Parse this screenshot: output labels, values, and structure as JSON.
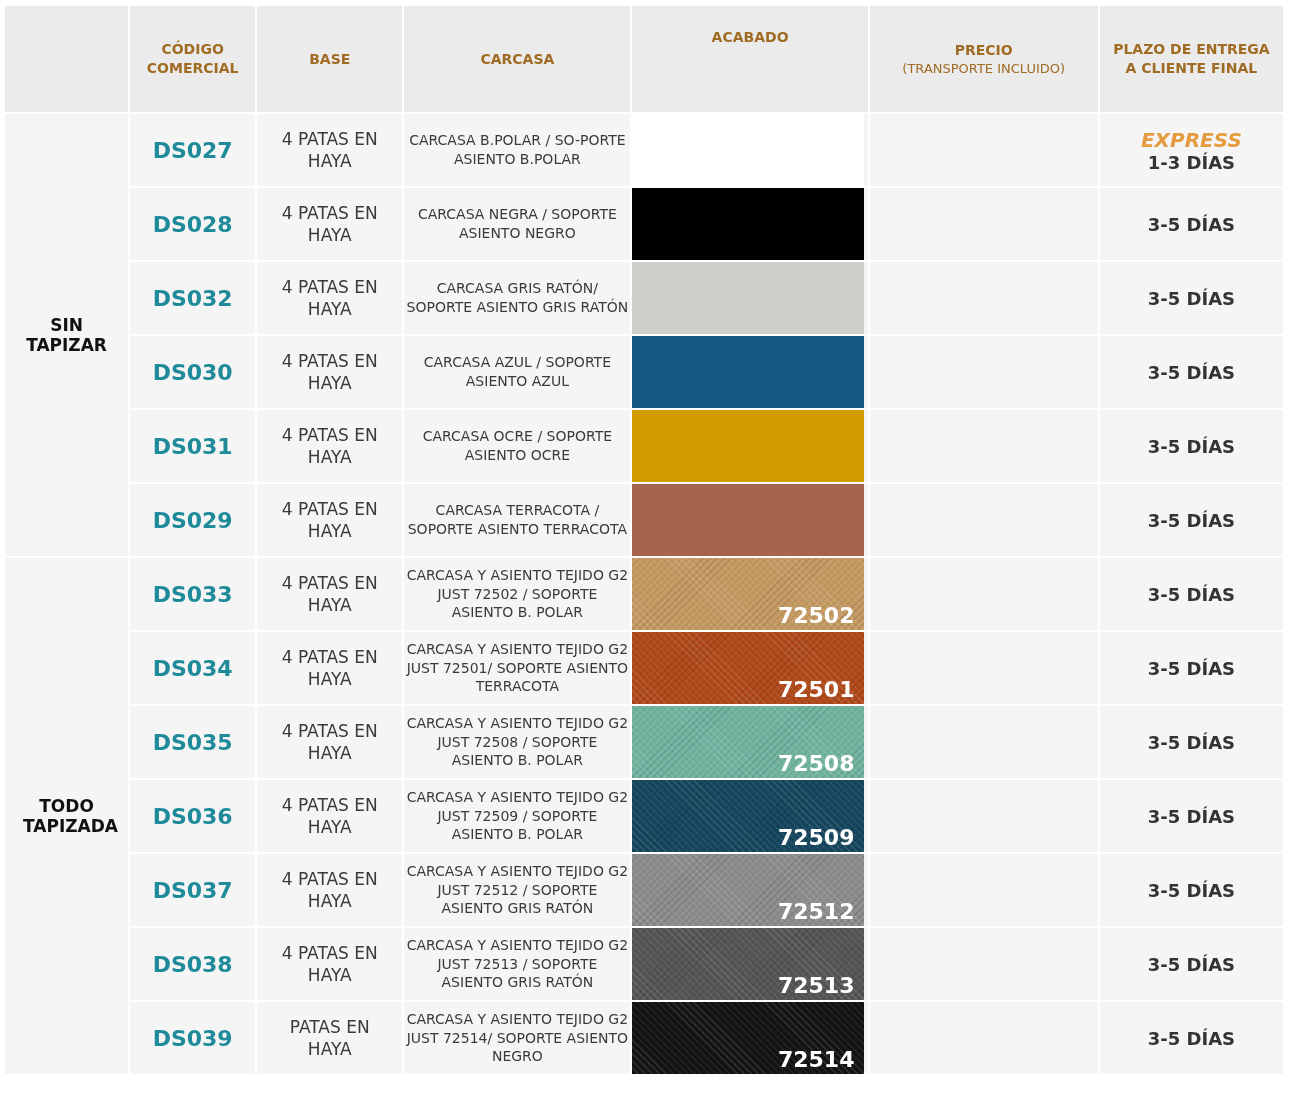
{
  "table": {
    "columns": [
      {},
      {
        "label": "CÓDIGO COMERCIAL"
      },
      {
        "label": "BASE"
      },
      {
        "label": "CARCASA"
      },
      {
        "label": "ACABADO"
      },
      {
        "label": "PRECIO",
        "sublabel": "(TRANSPORTE INCLUIDO)"
      },
      {
        "label": "PLAZO DE ENTREGA A CLIENTE FINAL"
      }
    ],
    "groups": [
      {
        "label": "SIN TAPIZAR",
        "rows": [
          {
            "code": "DS027",
            "base": "4 PATAS EN HAYA",
            "carcasa": "CARCASA B.POLAR / SO-PORTE ASIENTO B.POLAR",
            "finish": {
              "kind": "solid",
              "color": "#ffffff"
            },
            "badge": "EXPRESS",
            "delivery": "1-3 DÍAS"
          },
          {
            "code": "DS028",
            "base": "4 PATAS EN HAYA",
            "carcasa": "CARCASA NEGRA / SOPORTE ASIENTO NEGRO",
            "finish": {
              "kind": "solid",
              "color": "#000000"
            },
            "delivery": "3-5 DÍAS"
          },
          {
            "code": "DS032",
            "base": "4 PATAS EN HAYA",
            "carcasa": "CARCASA GRIS RATÓN/ SOPORTE ASIENTO GRIS RATÓN",
            "finish": {
              "kind": "solid",
              "color": "#d1cfcb"
            },
            "delivery": "3-5 DÍAS"
          },
          {
            "code": "DS030",
            "base": "4 PATAS EN HAYA",
            "carcasa": "CARCASA AZUL / SOPORTE ASIENTO AZUL",
            "finish": {
              "kind": "solid",
              "color": "#145a82"
            },
            "delivery": "3-5 DÍAS"
          },
          {
            "code": "DS031",
            "base": "4 PATAS EN HAYA",
            "carcasa": "CARCASA OCRE / SOPORTE ASIENTO OCRE",
            "finish": {
              "kind": "solid",
              "color": "#d19c00"
            },
            "delivery": "3-5 DÍAS"
          },
          {
            "code": "DS029",
            "base": "4 PATAS EN HAYA",
            "carcasa": "CARCASA TERRACOTA / SOPORTE ASIENTO TERRACOTA",
            "finish": {
              "kind": "solid",
              "color": "#a8634f"
            },
            "delivery": "3-5 DÍAS"
          }
        ]
      },
      {
        "label": "TODO TAPIZADA",
        "rows": [
          {
            "code": "DS033",
            "base": "4 PATAS EN HAYA",
            "carcasa": "CARCASA Y ASIENTO TEJIDO G2 JUST  72502 / SOPORTE ASIENTO B. POLAR",
            "finish": {
              "kind": "fabric",
              "color": "#c49a62",
              "code": "72502"
            },
            "delivery": "3-5 DÍAS"
          },
          {
            "code": "DS034",
            "base": "4 PATAS EN HAYA",
            "carcasa": "CARCASA Y ASIENTO TEJIDO G2 JUST  72501/ SOPORTE ASIENTO TERRACOTA",
            "finish": {
              "kind": "fabric",
              "color": "#b04a1a",
              "code": "72501"
            },
            "delivery": "3-5 DÍAS"
          },
          {
            "code": "DS035",
            "base": "4 PATAS EN HAYA",
            "carcasa": "CARCASA Y ASIENTO TEJIDO G2 JUST  72508 / SOPORTE ASIENTO B. POLAR",
            "finish": {
              "kind": "fabric",
              "color": "#72b3a0",
              "code": "72508"
            },
            "delivery": "3-5 DÍAS"
          },
          {
            "code": "DS036",
            "base": "4 PATAS EN HAYA",
            "carcasa": "CARCASA Y ASIENTO TEJIDO G2 JUST  72509 / SOPORTE ASIENTO B. POLAR",
            "finish": {
              "kind": "fabric",
              "color": "#16475e",
              "code": "72509"
            },
            "delivery": "3-5 DÍAS"
          },
          {
            "code": "DS037",
            "base": "4 PATAS EN HAYA",
            "carcasa": "CARCASA Y ASIENTO TEJIDO G2 JUST  72512 / SOPORTE ASIENTO GRIS RATÓN",
            "finish": {
              "kind": "fabric",
              "color": "#8c8c8c",
              "code": "72512"
            },
            "delivery": "3-5 DÍAS"
          },
          {
            "code": "DS038",
            "base": "4 PATAS EN HAYA",
            "carcasa": "CARCASA Y ASIENTO TEJIDO G2 JUST  72513 / SOPORTE ASIENTO GRIS RATÓN",
            "finish": {
              "kind": "fabric",
              "color": "#555555",
              "code": "72513"
            },
            "delivery": "3-5 DÍAS"
          },
          {
            "code": "DS039",
            "base": "PATAS EN HAYA",
            "carcasa": "CARCASA Y ASIENTO TEJIDO G2 JUST  72514/ SOPORTE ASIENTO NEGRO",
            "finish": {
              "kind": "fabric",
              "color": "#141414",
              "code": "72514"
            },
            "delivery": "3-5 DÍAS"
          }
        ]
      }
    ]
  }
}
